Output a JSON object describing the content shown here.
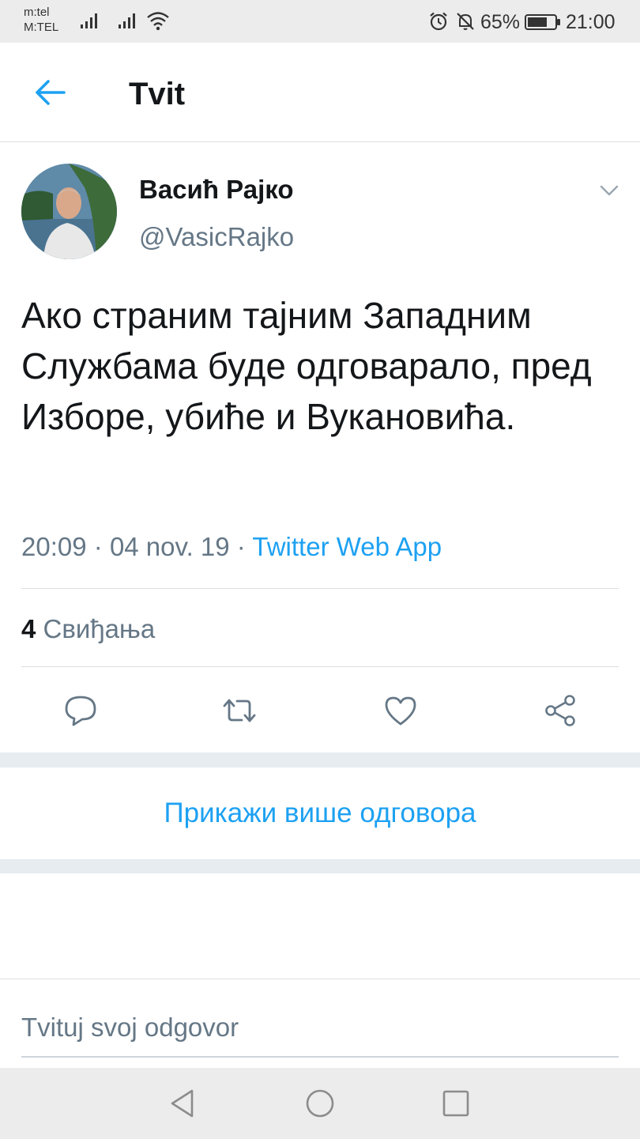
{
  "status_bar": {
    "carrier_1": "m:tel",
    "carrier_2": "M:TEL",
    "battery": "65%",
    "time": "21:00"
  },
  "header": {
    "title": "Tvit",
    "back_icon": "arrow-left-icon"
  },
  "tweet": {
    "author_name": "Васић Рајко",
    "author_handle": "@VasicRajko",
    "text": "Ако страним тајним Западним Службама буде одговарало, пред Изборе, убиће и Вукановића.",
    "time": "20:09",
    "date": "04 nov. 19",
    "separator": "·",
    "source": "Twitter Web App",
    "likes_count": "4",
    "likes_label": "Свиђања"
  },
  "actions": [
    "reply-icon",
    "retweet-icon",
    "like-icon",
    "share-icon"
  ],
  "show_more_label": "Прикажи више одговора",
  "reply": {
    "placeholder": "Tvituj svoj odgovor"
  },
  "colors": {
    "accent": "#1da1f2",
    "secondary_text": "#657786",
    "primary_text": "#14171a",
    "band": "#e6ecf0"
  }
}
